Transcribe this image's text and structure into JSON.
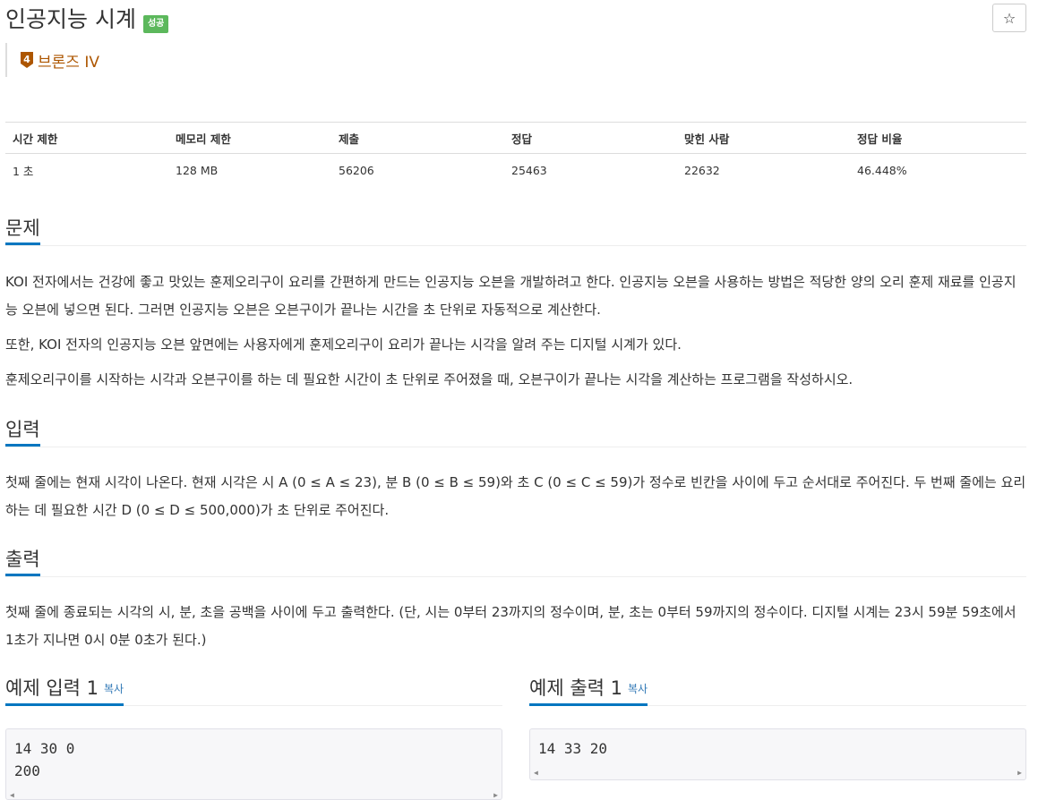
{
  "problem": {
    "title": "인공지능 시계",
    "status_badge": "성공",
    "star_icon": "☆",
    "tier": {
      "number": "4",
      "label": "브론즈 IV",
      "color": "#ad5600"
    }
  },
  "info_table": {
    "headers": [
      "시간 제한",
      "메모리 제한",
      "제출",
      "정답",
      "맞힌 사람",
      "정답 비율"
    ],
    "values": [
      "1 초",
      "128 MB",
      "56206",
      "25463",
      "22632",
      "46.448%"
    ]
  },
  "sections": {
    "description": {
      "heading": "문제",
      "paragraphs": [
        "KOI 전자에서는 건강에 좋고 맛있는 훈제오리구이 요리를 간편하게 만드는 인공지능 오븐을 개발하려고 한다. 인공지능 오븐을 사용하는 방법은 적당한 양의 오리 훈제 재료를 인공지능 오븐에 넣으면 된다. 그러면 인공지능 오븐은 오븐구이가 끝나는 시간을 초 단위로 자동적으로 계산한다.",
        "또한, KOI 전자의 인공지능 오븐 앞면에는 사용자에게 훈제오리구이 요리가 끝나는 시각을 알려 주는 디지털 시계가 있다.",
        "훈제오리구이를 시작하는 시각과 오븐구이를 하는 데 필요한 시간이 초 단위로 주어졌을 때, 오븐구이가 끝나는 시각을 계산하는 프로그램을 작성하시오."
      ]
    },
    "input": {
      "heading": "입력",
      "paragraphs": [
        "첫째 줄에는 현재 시각이 나온다. 현재 시각은 시 A (0 ≤ A ≤ 23), 분 B (0 ≤ B ≤ 59)와 초 C (0 ≤ C ≤ 59)가 정수로 빈칸을 사이에 두고 순서대로 주어진다. 두 번째 줄에는 요리하는 데 필요한 시간 D (0 ≤ D ≤ 500,000)가 초 단위로 주어진다."
      ]
    },
    "output": {
      "heading": "출력",
      "paragraphs": [
        "첫째 줄에 종료되는 시각의 시, 분, 초을 공백을 사이에 두고 출력한다. (단, 시는 0부터 23까지의 정수이며, 분, 초는 0부터 59까지의 정수이다. 디지털 시계는 23시 59분 59초에서 1초가 지나면 0시 0분 0초가 된다.)"
      ]
    }
  },
  "samples": {
    "input": {
      "heading": "예제 입력 1",
      "copy_label": "복사",
      "content": "14 30 0\n200"
    },
    "output": {
      "heading": "예제 출력 1",
      "copy_label": "복사",
      "content": "14 33 20"
    }
  },
  "colors": {
    "accent": "#0076c0",
    "success": "#5cb85c",
    "link": "#337ab7"
  }
}
